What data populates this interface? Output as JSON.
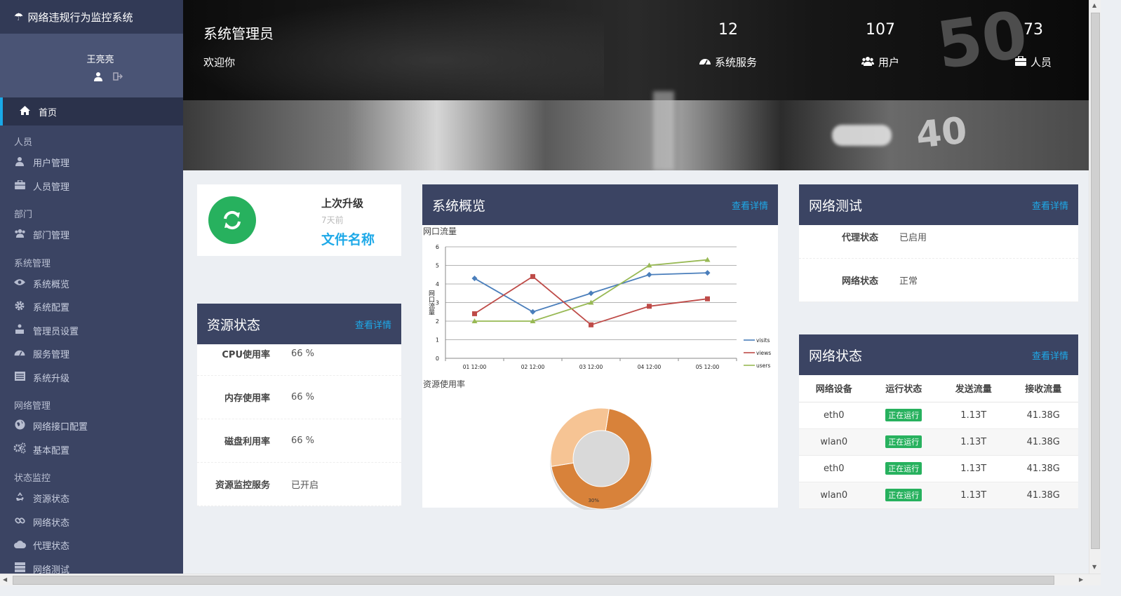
{
  "app": {
    "title": "网络违规行为监控系统",
    "icon": "umbrella-icon"
  },
  "user": {
    "name": "王亮亮"
  },
  "nav": {
    "home": "首页",
    "groups": [
      {
        "label": "人员",
        "items": [
          {
            "label": "用户管理",
            "icon": "user-icon"
          },
          {
            "label": "人员管理",
            "icon": "briefcase-icon"
          }
        ]
      },
      {
        "label": "部门",
        "items": [
          {
            "label": "部门管理",
            "icon": "users-icon"
          }
        ]
      },
      {
        "label": "系统管理",
        "items": [
          {
            "label": "系统概览",
            "icon": "eye-icon"
          },
          {
            "label": "系统配置",
            "icon": "gear-icon"
          },
          {
            "label": "管理员设置",
            "icon": "sitemap-icon"
          },
          {
            "label": "服务管理",
            "icon": "dashboard-icon"
          },
          {
            "label": "系统升级",
            "icon": "list-icon"
          }
        ]
      },
      {
        "label": "网络管理",
        "items": [
          {
            "label": "网络接口配置",
            "icon": "globe-icon"
          },
          {
            "label": "基本配置",
            "icon": "gears-icon"
          }
        ]
      },
      {
        "label": "状态监控",
        "items": [
          {
            "label": "资源状态",
            "icon": "recycle-icon"
          },
          {
            "label": "网络状态",
            "icon": "link-icon"
          },
          {
            "label": "代理状态",
            "icon": "cloud-icon"
          },
          {
            "label": "网络测试",
            "icon": "server-icon"
          }
        ]
      }
    ]
  },
  "banner": {
    "title": "系统管理员",
    "welcome": "欢迎你",
    "stats": [
      {
        "value": "12",
        "label": "系统服务",
        "icon": "dashboard-icon"
      },
      {
        "value": "107",
        "label": "用户",
        "icon": "users-icon"
      },
      {
        "value": "73",
        "label": "人员",
        "icon": "briefcase-icon"
      }
    ]
  },
  "upgrade": {
    "title": "上次升级",
    "time": "7天前",
    "file": "文件名称"
  },
  "resource": {
    "title": "资源状态",
    "more": "查看详情",
    "rows": [
      {
        "k": "CPU使用率",
        "v": "66 %"
      },
      {
        "k": "内存使用率",
        "v": "66 %"
      },
      {
        "k": "磁盘利用率",
        "v": "66 %"
      },
      {
        "k": "资源监控服务",
        "v": "已开启"
      }
    ]
  },
  "overview": {
    "title": "系统概览",
    "more": "查看详情",
    "chart1_title": "网口流量",
    "chart2_title": "资源使用率"
  },
  "nettest": {
    "title": "网络测试",
    "more": "查看详情",
    "rows": [
      {
        "k": "代理状态",
        "v": "已启用"
      },
      {
        "k": "网络状态",
        "v": "正常"
      }
    ]
  },
  "netstatus": {
    "title": "网络状态",
    "more": "查看详情",
    "headers": [
      "网络设备",
      "运行状态",
      "发送流量",
      "接收流量"
    ],
    "rows": [
      [
        "eth0",
        "正在运行",
        "1.13T",
        "41.38G"
      ],
      [
        "wlan0",
        "正在运行",
        "1.13T",
        "41.38G"
      ],
      [
        "eth0",
        "正在运行",
        "1.13T",
        "41.38G"
      ],
      [
        "wlan0",
        "正在运行",
        "1.13T",
        "41.38G"
      ]
    ]
  },
  "colors": {
    "sidebar": "#3b4463",
    "accent": "#1ea9e8",
    "green": "#27b15e",
    "visits": "#4a7ebb",
    "views": "#be4b48",
    "users": "#98b954",
    "donut_main": "#d8823a",
    "donut_light": "#f6c494"
  },
  "chart_data": [
    {
      "type": "line",
      "title": "网口流量",
      "ylabel": "网口流量",
      "x": [
        "01 12:00",
        "02 12:00",
        "03 12:00",
        "04 12:00",
        "05 12:00"
      ],
      "ylim": [
        0,
        6
      ],
      "yticks": [
        0,
        1,
        2,
        3,
        4,
        5,
        6
      ],
      "grid": true,
      "legend": "right",
      "series": [
        {
          "name": "visits",
          "values": [
            4.3,
            2.5,
            3.5,
            4.5,
            4.6
          ]
        },
        {
          "name": "views",
          "values": [
            2.4,
            4.4,
            1.8,
            2.8,
            3.2
          ]
        },
        {
          "name": "users",
          "values": [
            2.0,
            2.0,
            3.0,
            5.0,
            5.3
          ]
        }
      ]
    },
    {
      "type": "pie",
      "title": "资源使用率",
      "donut": true,
      "slices": [
        {
          "value": 70,
          "label": "70%"
        },
        {
          "value": 30,
          "label": "30%"
        }
      ]
    }
  ]
}
